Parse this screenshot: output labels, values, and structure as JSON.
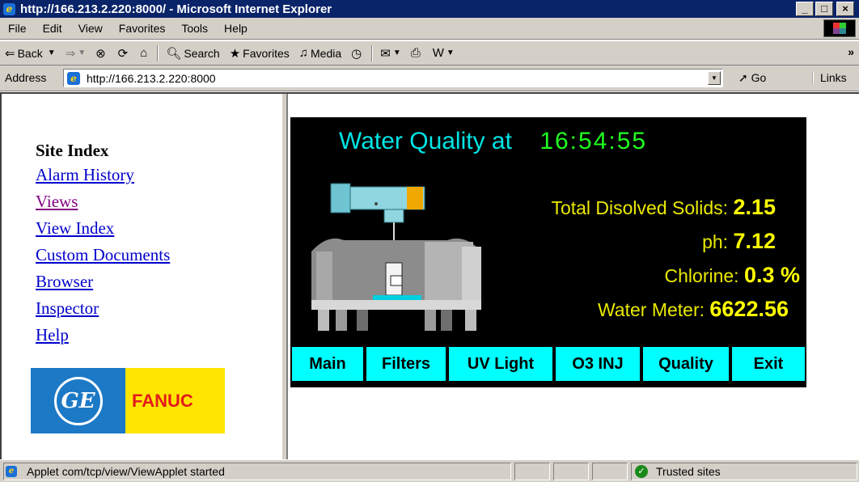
{
  "window": {
    "title": "http://166.213.2.220:8000/ - Microsoft Internet Explorer",
    "minimize": "_",
    "maximize": "□",
    "close": "×"
  },
  "menu": [
    "File",
    "Edit",
    "View",
    "Favorites",
    "Tools",
    "Help"
  ],
  "toolbar": {
    "back": "Back",
    "search": "Search",
    "favorites": "Favorites",
    "media": "Media",
    "more": "»"
  },
  "address": {
    "label": "Address",
    "url": "http://166.213.2.220:8000",
    "go": "Go",
    "links": "Links"
  },
  "sidebar": {
    "title": "Site Index",
    "links": [
      {
        "label": "Alarm History",
        "visited": false
      },
      {
        "label": "Views",
        "visited": true
      },
      {
        "label": "View Index",
        "visited": false
      },
      {
        "label": "Custom Documents",
        "visited": false
      },
      {
        "label": "Browser",
        "visited": false
      },
      {
        "label": "Inspector",
        "visited": false
      },
      {
        "label": "Help",
        "visited": false
      }
    ],
    "logo": {
      "mark": "GE",
      "brand": "FANUC"
    }
  },
  "applet": {
    "heading": "Water Quality at",
    "time": "16:54:55",
    "readings": [
      {
        "label": "Total Disolved Solids:",
        "value": "2.15"
      },
      {
        "label": "ph:",
        "value": "7.12"
      },
      {
        "label": "Chlorine:",
        "value": "0.3 %"
      },
      {
        "label": "Water Meter:",
        "value": "6622.56"
      }
    ],
    "buttons": [
      "Main",
      "Filters",
      "UV Light",
      "O3 INJ",
      "Quality",
      "Exit"
    ],
    "colors": {
      "background": "#000000",
      "heading": "#00e5e5",
      "time": "#20ff20",
      "values": "#ffff00",
      "buttons": "#00ffff"
    }
  },
  "status": {
    "message": "Applet com/tcp/view/ViewApplet started",
    "zone": "Trusted sites"
  }
}
